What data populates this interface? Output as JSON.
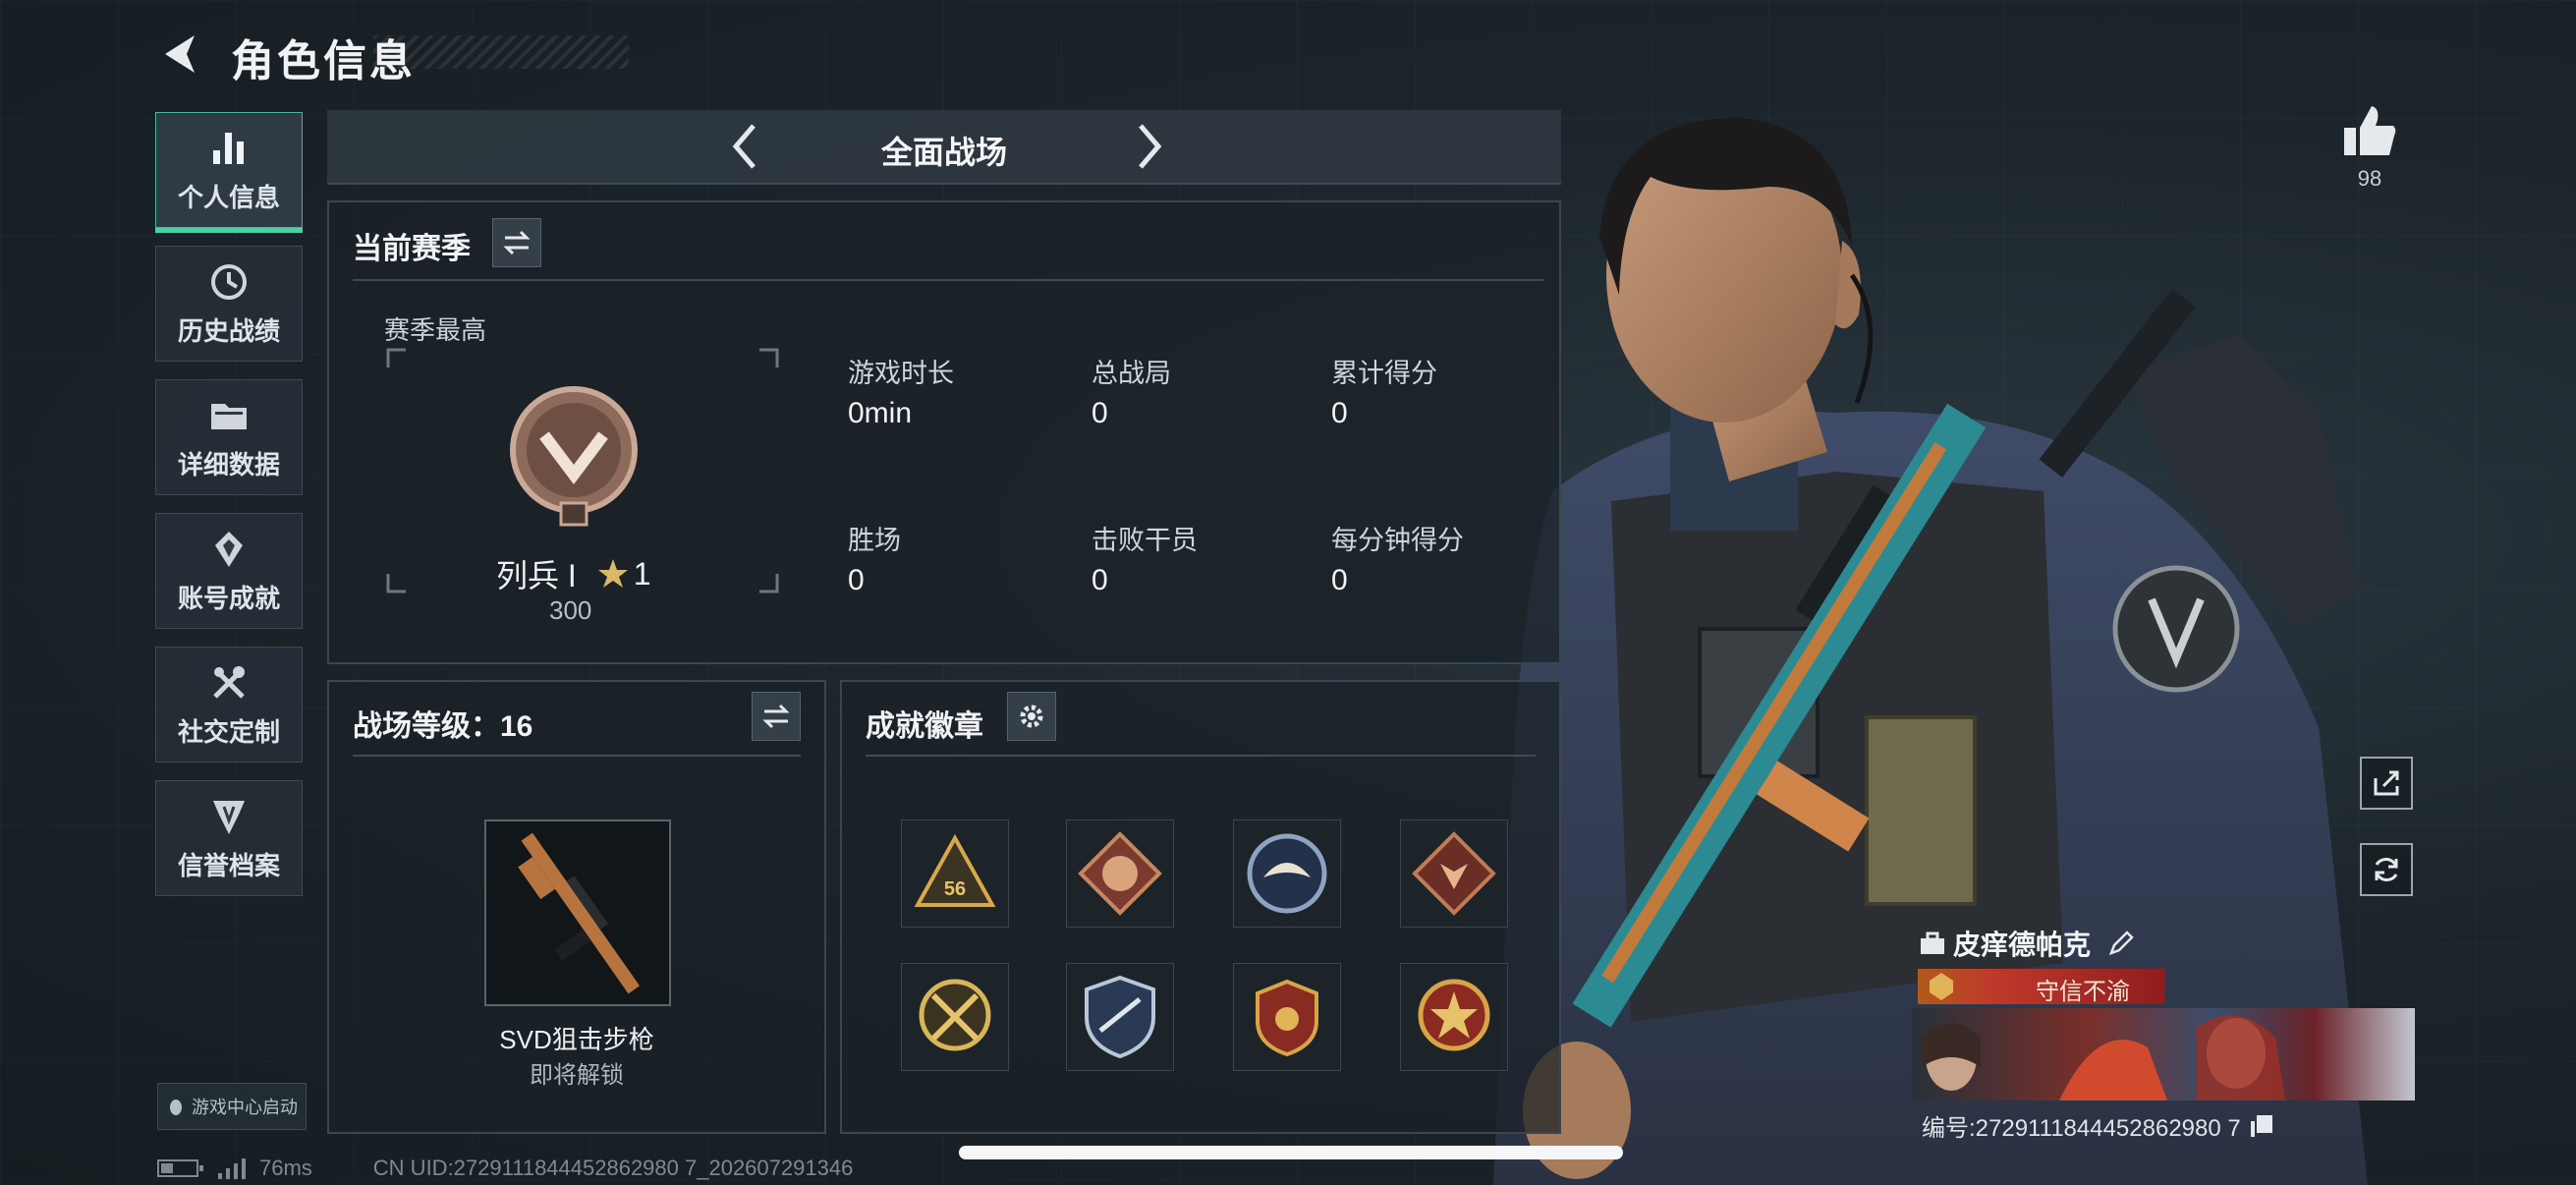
{
  "header": {
    "title": "角色信息"
  },
  "sidebar": {
    "items": [
      {
        "label": "个人信息",
        "icon": "bar-chart-icon"
      },
      {
        "label": "历史战绩",
        "icon": "history-icon"
      },
      {
        "label": "详细数据",
        "icon": "folder-icon"
      },
      {
        "label": "账号成就",
        "icon": "achievement-icon"
      },
      {
        "label": "社交定制",
        "icon": "tools-icon"
      },
      {
        "label": "信誉档案",
        "icon": "credit-icon"
      }
    ],
    "game_center": "游戏中心启动"
  },
  "mode": {
    "title": "全面战场"
  },
  "season": {
    "title": "当前赛季",
    "best_label": "赛季最高",
    "rank_name": "列兵 I",
    "stars": "1",
    "rank_score": "300",
    "stats": [
      {
        "label": "游戏时长",
        "value": "0min"
      },
      {
        "label": "总战局",
        "value": "0"
      },
      {
        "label": "累计得分",
        "value": "0"
      },
      {
        "label": "胜场",
        "value": "0"
      },
      {
        "label": "击败干员",
        "value": "0"
      },
      {
        "label": "每分钟得分",
        "value": "0"
      }
    ]
  },
  "battlefield_level": {
    "title": "战场等级：16",
    "weapon_name": "SVD狙击步枪",
    "weapon_status": "即将解锁"
  },
  "achievements": {
    "title": "成就徽章",
    "badge_number": "56"
  },
  "profile": {
    "likes": "98",
    "player_name": "皮痒德帕克",
    "title_badge": "守信不渝",
    "uid_line": "编号:2729111844452862980 7",
    "cn_uid": "CN UID:2729111844452862980 7_202607291346",
    "ping": "76ms"
  },
  "colors": {
    "accent": "#4fd0a4",
    "title_red": "#c0392b"
  }
}
